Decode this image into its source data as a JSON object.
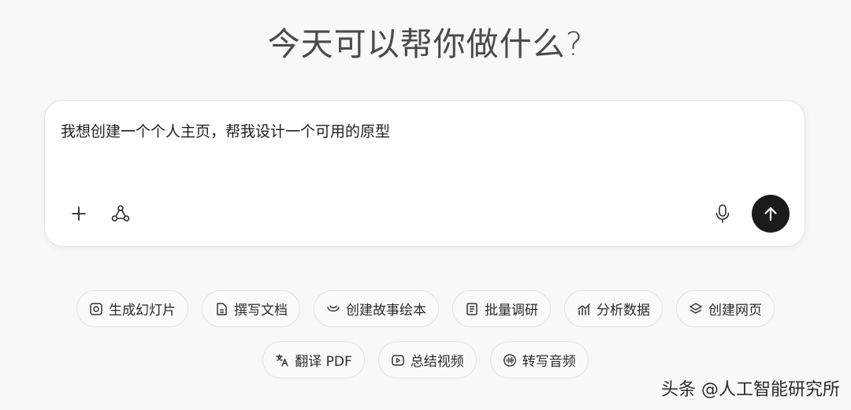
{
  "headline": "今天可以帮你做什么?",
  "composer": {
    "text": "我想创建一个个人主页，帮我设计一个可用的原型",
    "add_icon": "plus-icon",
    "agent_icon": "nodes-icon",
    "mic_icon": "microphone-icon",
    "send_icon": "arrow-up-icon"
  },
  "chips_row1": [
    {
      "label": "生成幻灯片",
      "icon": "slides-icon"
    },
    {
      "label": "撰写文档",
      "icon": "document-icon"
    },
    {
      "label": "创建故事绘本",
      "icon": "storybook-icon"
    },
    {
      "label": "批量调研",
      "icon": "research-icon"
    },
    {
      "label": "分析数据",
      "icon": "chart-icon"
    },
    {
      "label": "创建网页",
      "icon": "layers-icon"
    }
  ],
  "chips_row2": [
    {
      "label": "翻译 PDF",
      "icon": "translate-icon"
    },
    {
      "label": "总结视频",
      "icon": "video-icon"
    },
    {
      "label": "转写音频",
      "icon": "audio-icon"
    }
  ],
  "watermark": "头条 @人工智能研究所"
}
